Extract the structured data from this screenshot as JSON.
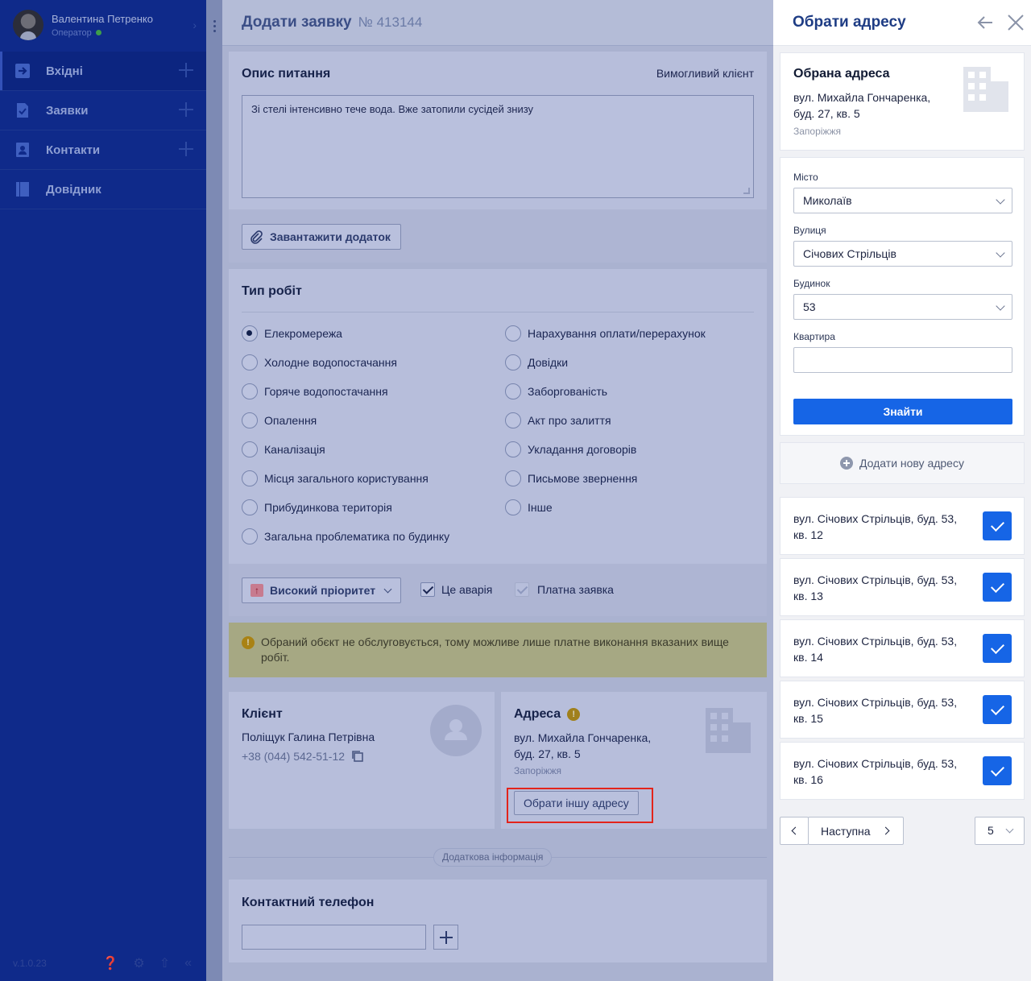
{
  "sidebar": {
    "user_name": "Валентина Петренко",
    "user_role": "Оператор",
    "items": [
      {
        "label": "Вхідні"
      },
      {
        "label": "Заявки"
      },
      {
        "label": "Контакти"
      },
      {
        "label": "Довідник"
      }
    ],
    "version": "v.1.0.23"
  },
  "main": {
    "title": "Додати заявку",
    "number": "№ 413144",
    "description": {
      "title": "Опис питання",
      "client_tag": "Вимогливий клієнт",
      "text": "Зі стелі інтенсивно тече вода. Вже затопили сусідей знизу",
      "upload_label": "Завантажити додаток"
    },
    "work_types": {
      "title": "Тип робіт",
      "left": [
        "Елекромережа",
        "Холодне водопостачання",
        "Горяче водопостачання",
        "Опалення",
        "Каналізація",
        "Місця загального користування",
        "Прибудинкова територія",
        "Загальна проблематика по будинку"
      ],
      "right": [
        "Нарахування оплати/перерахунок",
        "Довідки",
        "Заборгованість",
        "Акт про залиття",
        "Укладання договорів",
        "Письмове звернення",
        "Інше"
      ],
      "selected": "Елекромережа",
      "priority_label": "Високий пріоритет",
      "emergency_label": "Це аварія",
      "paid_label": "Платна заявка"
    },
    "warning": "Обраний обєкт не обслуговується, тому можливе лише платне виконання вказаних вище робіт.",
    "client": {
      "title": "Клієнт",
      "name": "Поліщук Галина Петрівна",
      "phone": "+38 (044) 542-51-12"
    },
    "address": {
      "title": "Адреса",
      "line1": "вул. Михайла Гончаренка,",
      "line2": "буд. 27, кв. 5",
      "city": "Запоріжжя",
      "change_label": "Обрати іншу адресу"
    },
    "extra_info_label": "Додаткова інформація",
    "contact_phone": {
      "title": "Контактний телефон",
      "value": ""
    }
  },
  "panel": {
    "title": "Обрати адресу",
    "selected": {
      "title": "Обрана адреса",
      "line1": "вул. Михайла Гончаренка,",
      "line2": "буд. 27, кв. 5",
      "city": "Запоріжжя"
    },
    "form": {
      "city_label": "Місто",
      "city_value": "Миколаїв",
      "street_label": "Вулиця",
      "street_value": "Січових Стрільців",
      "house_label": "Будинок",
      "house_value": "53",
      "apartment_label": "Квартира",
      "apartment_value": "",
      "find_label": "Знайти"
    },
    "add_new_label": "Додати нову адресу",
    "results": [
      {
        "line1": "вул. Січових Стрільців, буд. 53,",
        "line2": "кв. 12"
      },
      {
        "line1": "вул. Січових Стрільців, буд. 53,",
        "line2": "кв. 13"
      },
      {
        "line1": "вул. Січових Стрільців, буд. 53,",
        "line2": "кв. 14"
      },
      {
        "line1": "вул. Січових Стрільців, буд. 53,",
        "line2": "кв. 15"
      },
      {
        "line1": "вул. Січових Стрільців, буд. 53,",
        "line2": "кв. 16"
      }
    ],
    "pagination": {
      "next_label": "Наступна",
      "page_size": "5"
    }
  },
  "colors": {
    "sidebar_bg": "#0f2a8a",
    "primary": "#1665e6",
    "highlight": "#e3241b",
    "warning_bg": "#a6a883"
  },
  "icons": [
    "inbox-icon",
    "requests-icon",
    "contacts-icon",
    "book-icon",
    "help-icon",
    "settings-icon",
    "share-icon",
    "collapse-icon",
    "paperclip-icon",
    "building-icon",
    "user-icon",
    "copy-icon",
    "plus-circle-icon",
    "back-arrow-icon",
    "close-icon",
    "check-icon"
  ]
}
